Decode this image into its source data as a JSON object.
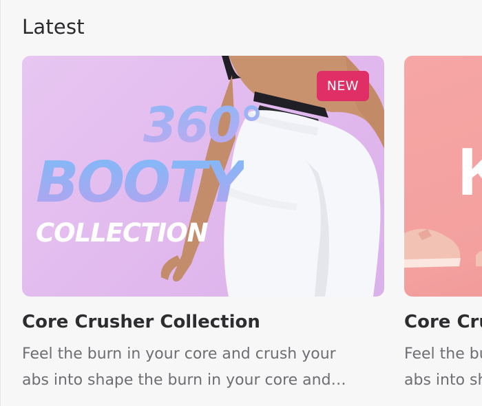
{
  "section": {
    "title": "Latest"
  },
  "cards": [
    {
      "badge": "NEW",
      "promo": {
        "line1": "360°",
        "line2": "BOOTY",
        "line3": "COLLECTION"
      },
      "title": "Core Crusher Collection",
      "description": "Feel the burn in your core and crush your abs into shape the burn in your core and crush your abs into shape"
    },
    {
      "promo": {
        "line1": "K"
      },
      "title": "Core Crusher Collection",
      "description": "Feel the burn in your core and crush your abs into shape the burn in your core and crush your abs into shape"
    }
  ],
  "colors": {
    "badge": "#df2f66",
    "card1_background": "#e3bdef",
    "card2_background": "#f4a3a2",
    "title_text": "#2d2d30",
    "description_text": "#6e6e72"
  }
}
